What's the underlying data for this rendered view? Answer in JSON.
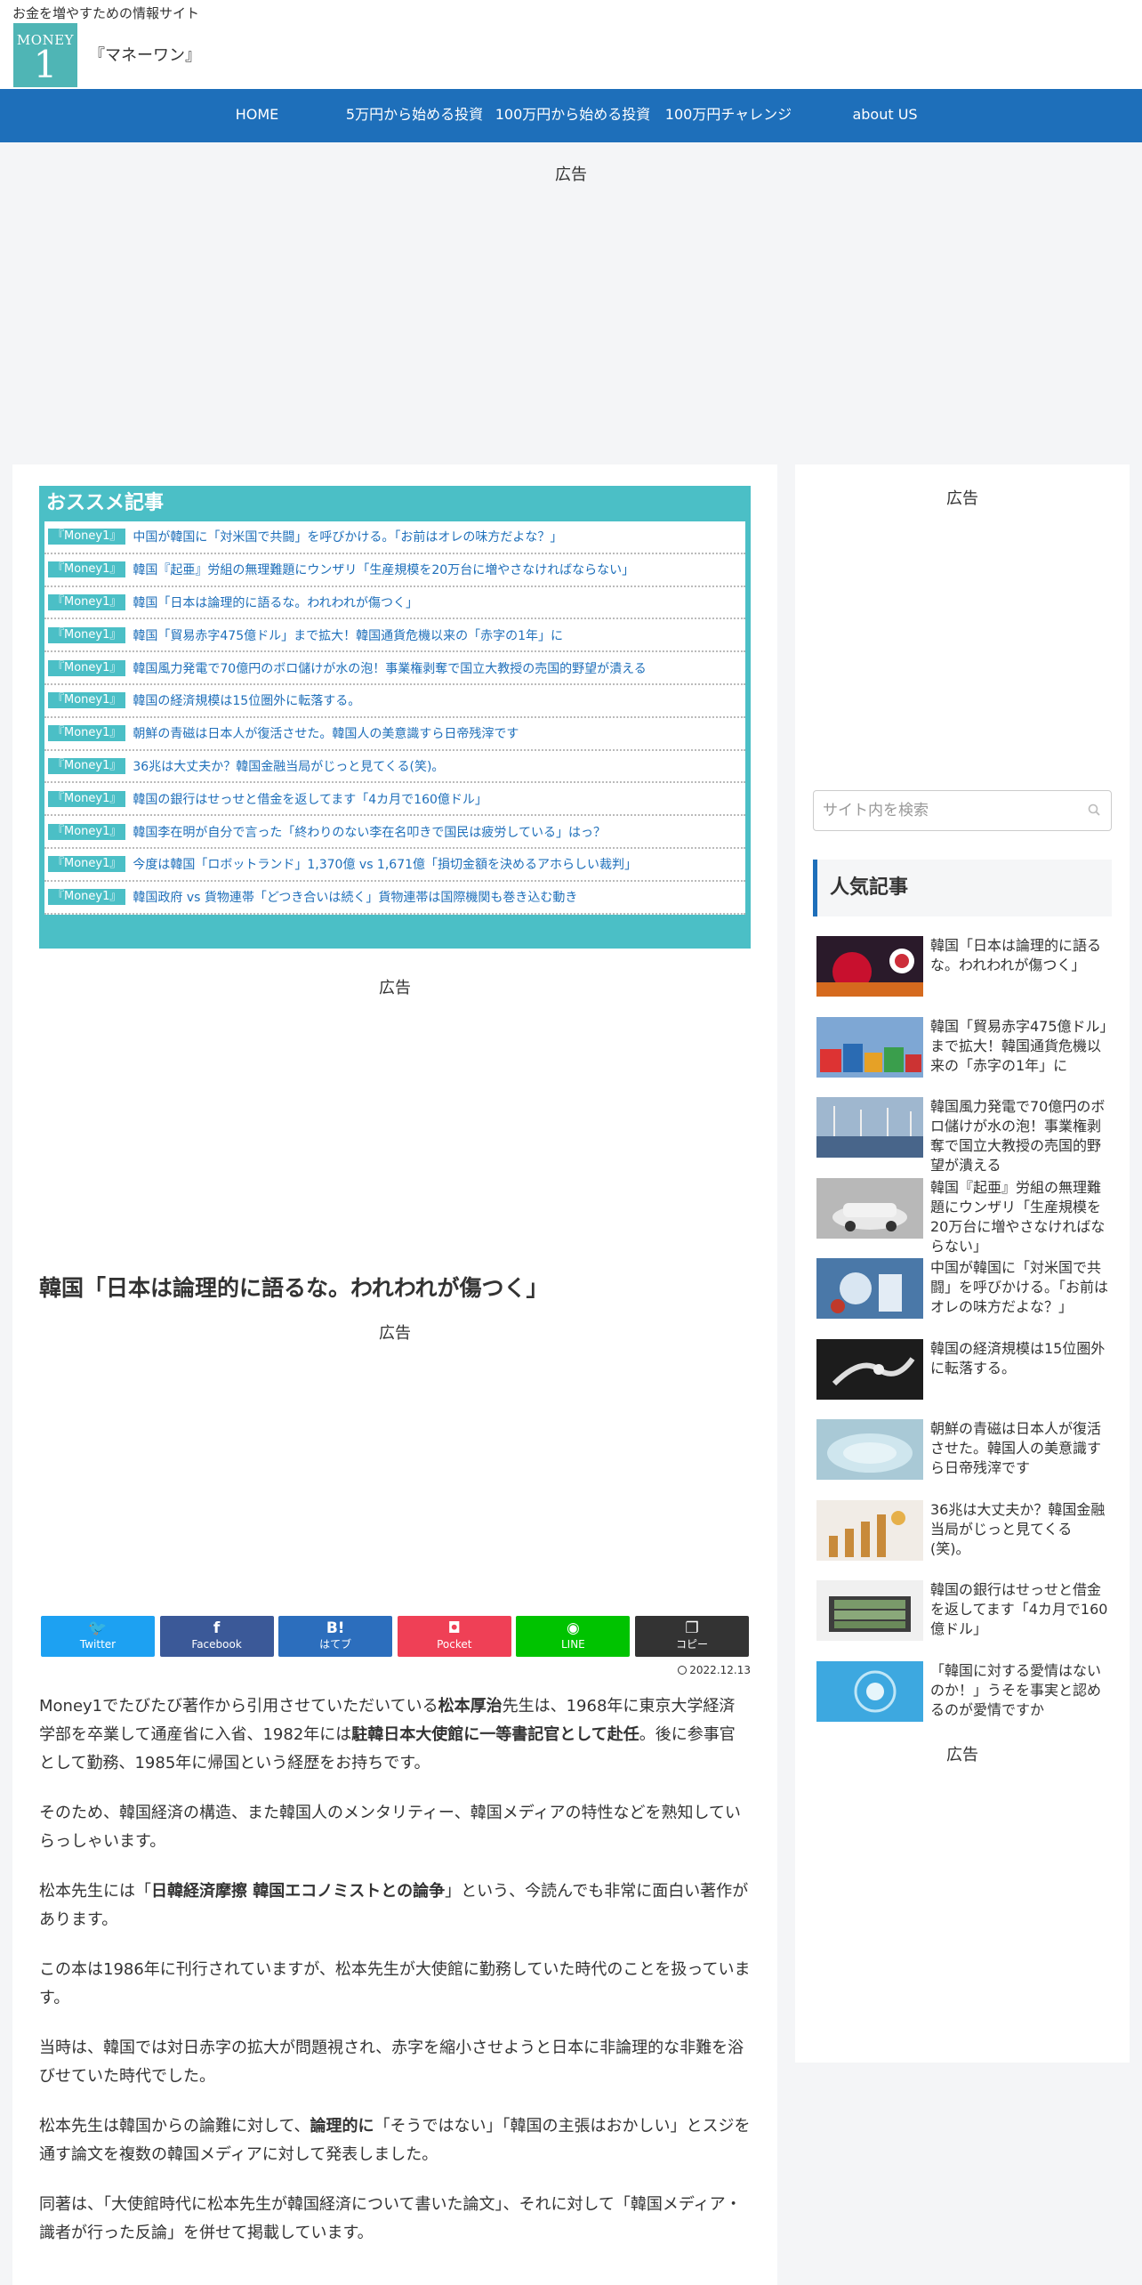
{
  "header": {
    "tagline": "お金を増やすための情報サイト",
    "logo_top": "MONEY",
    "logo_bottom": "1",
    "site_name": "『マネーワン』"
  },
  "nav": {
    "items": [
      {
        "label": "HOME"
      },
      {
        "label": "5万円から始める投資"
      },
      {
        "label": "100万円から始める投資"
      },
      {
        "label": "100万円チャレンジ"
      },
      {
        "label": "about US"
      }
    ]
  },
  "ads": {
    "label": "広告"
  },
  "recommended": {
    "title": "おススメ記事",
    "badge": "『Money1』",
    "items": [
      "中国が韓国に「対米国で共闘」を呼びかける。「お前はオレの味方だよな？」",
      "韓国『起亜』労組の無理難題にウンザリ「生産規模を20万台に増やさなければならない」",
      "韓国「日本は論理的に語るな。われわれが傷つく」",
      "韓国「貿易赤字475億ドル」まで拡大！韓国通貨危機以来の「赤字の1年」に",
      "韓国風力発電で70億円のボロ儲けが水の泡！事業権剥奪で国立大教授の売国的野望が潰える",
      "韓国の経済規模は15位圏外に転落する。",
      "朝鮮の青磁は日本人が復活させた。韓国人の美意識すら日帝残滓です",
      "36兆は大丈夫か？韓国金融当局がじっと見てくる(笑)。",
      "韓国の銀行はせっせと借金を返してます「4カ月で160億ドル」",
      "韓国李在明が自分で言った「終わりのない李在名叩きで国民は疲労している」はっ？",
      "今度は韓国「ロボットランド」1,370億 vs 1,671億「損切金額を決めるアホらしい裁判」",
      "韓国政府 vs 貨物連帯「どつき合いは続く」貨物連帯は国際機関も巻き込む動き"
    ]
  },
  "article": {
    "title": "韓国「日本は論理的に語るな。われわれが傷つく」",
    "date": "2022.12.13",
    "paragraphs": [
      [
        "Money1でたびたび著作から引用させていただいている",
        "松本厚治",
        "先生は、1968年に東京大学経済学部を卒業して通産省に入省、1982年には",
        "駐韓日本大使館に一等書記官として赴任",
        "。後に参事官として勤務、1985年に帰国という経歴をお持ちです。"
      ],
      [
        "そのため、韓国経済の構造、また韓国人のメンタリティー、韓国メディアの特性などを熟知していらっしゃいます。"
      ],
      [
        "松本先生には「",
        "日韓経済摩擦 韓国エコノミストとの論争",
        "」という、今読んでも非常に面白い著作があります。"
      ],
      [
        "この本は1986年に刊行されていますが、松本先生が大使館に勤務していた時代のことを扱っています。"
      ],
      [
        "当時は、韓国では対日赤字の拡大が問題視され、赤字を縮小させようと日本に非論理的な非難を浴びせていた時代でした。"
      ],
      [
        "松本先生は韓国からの論難に対して、",
        "論理的に",
        "「そうではない」「韓国の主張はおかしい」とスジを通す論文を複数の韓国メディアに対して発表しました。"
      ],
      [
        "同著は、「大使館時代に松本先生が韓国経済について書いた論文」、それに対して「韓国メディア・識者が行った反論」を併せて掲載しています。"
      ]
    ]
  },
  "share": {
    "buttons": [
      {
        "icon": "🐦",
        "label": "Twitter",
        "color": "#1da1f2"
      },
      {
        "icon": "f",
        "label": "Facebook",
        "color": "#3b5998"
      },
      {
        "icon": "B!",
        "label": "はてブ",
        "color": "#2c6ebd"
      },
      {
        "icon": "◘",
        "label": "Pocket",
        "color": "#ef4056"
      },
      {
        "icon": "◉",
        "label": "LINE",
        "color": "#00c300"
      },
      {
        "icon": "❐",
        "label": "コピー",
        "color": "#333333"
      }
    ]
  },
  "sidebar": {
    "search_placeholder": "サイト内を検索",
    "popular_title": "人気記事",
    "popular": [
      "韓国「日本は論理的に語るな。われわれが傷つく」",
      "韓国「貿易赤字475億ドル」まで拡大！韓国通貨危機以来の「赤字の1年」に",
      "韓国風力発電で70億円のボロ儲けが水の泡！事業権剥奪で国立大教授の売国的野望が潰える",
      "韓国『起亜』労組の無理難題にウンザリ「生産規模を20万台に増やさなければならない」",
      "中国が韓国に「対米国で共闘」を呼びかける。「お前はオレの味方だよな？」",
      "韓国の経済規模は15位圏外に転落する。",
      "朝鮮の青磁は日本人が復活させた。韓国人の美意識すら日帝残滓です",
      "36兆は大丈夫か？韓国金融当局がじっと見てくる(笑)。",
      "韓国の銀行はせっせと借金を返してます「4カ月で160億ドル」",
      "「韓国に対する愛情はないのか！」うそを事実と認めるのが愛情ですか"
    ]
  }
}
